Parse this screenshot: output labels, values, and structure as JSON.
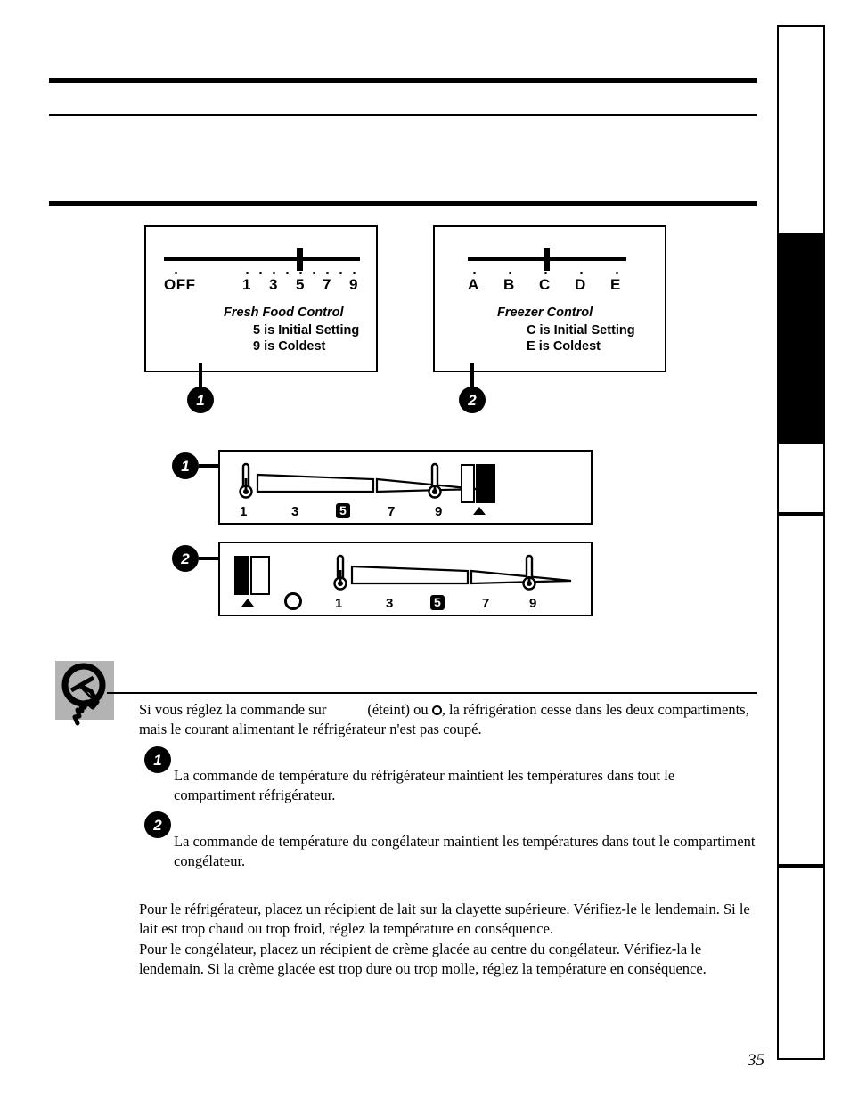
{
  "page": {
    "number": "35",
    "language": "fr"
  },
  "controls": {
    "fresh_food": {
      "name": "fresh-food-control",
      "scale_labels": [
        "OFF",
        "1",
        "3",
        "5",
        "7",
        "9"
      ],
      "caption_title": "Fresh Food Control",
      "caption_lines": [
        "5 is Initial Setting",
        "9 is Coldest"
      ],
      "thumb_position_label": "5"
    },
    "freezer": {
      "name": "freezer-control",
      "scale_labels": [
        "A",
        "B",
        "C",
        "D",
        "E"
      ],
      "caption_title": "Freezer Control",
      "caption_lines": [
        "C is Initial Setting",
        "E is Coldest"
      ],
      "thumb_position_label": "C"
    }
  },
  "callouts": {
    "panel_one": "1",
    "panel_two": "2",
    "dial_one": "1",
    "dial_two": "2",
    "text_one": "1",
    "text_two": "2"
  },
  "dials": {
    "fresh_food_dial": {
      "numbers": [
        "1",
        "3",
        "5",
        "7",
        "9"
      ],
      "highlighted": "5",
      "switch_icon": "rocker-switch-icon",
      "arrow_icon": "triangle-up-icon",
      "thermometer_icon": "thermometer-icon"
    },
    "freezer_dial": {
      "numbers": [
        "1",
        "3",
        "5",
        "7",
        "9"
      ],
      "highlighted": "5",
      "switch_icon": "rocker-switch-icon",
      "arrow_icon": "triangle-up-icon",
      "off_icon": "circle-off-icon",
      "thermometer_icon": "thermometer-icon"
    }
  },
  "text": {
    "note_part_1": "Si vous réglez la commande sur",
    "note_part_2": "(éteint) ou",
    "note_part_3": ", la réfrigération cesse dans les deux compartiments, mais le courant alimentant le réfrigérateur n'est pas coupé.",
    "item_1": "La commande de température du réfrigérateur maintient les températures dans tout le compartiment réfrigérateur.",
    "item_2": "La commande de température du congélateur maintient les températures dans tout le compartiment congélateur.",
    "para_3": "Pour le réfrigérateur, placez un récipient de lait sur la clayette supérieure. Vérifiez-le le lendemain. Si le lait est trop chaud ou trop froid, réglez la température en conséquence.",
    "para_4": "Pour le congélateur, placez un récipient de crème glacée au centre du congélateur. Vérifiez-la le lendemain. Si la crème glacée est trop dure ou trop molle, réglez la température en conséquence."
  },
  "colors": {
    "ink": "#000000",
    "paper": "#ffffff",
    "icon_gray": "#b3b3b3"
  }
}
